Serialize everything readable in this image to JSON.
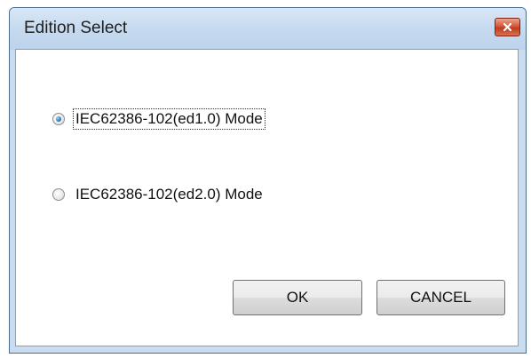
{
  "window": {
    "title": "Edition Select"
  },
  "options": [
    {
      "label": "IEC62386-102(ed1.0) Mode",
      "selected": true
    },
    {
      "label": "IEC62386-102(ed2.0) Mode",
      "selected": false
    }
  ],
  "buttons": {
    "ok_label": "OK",
    "cancel_label": "CANCEL"
  },
  "icons": {
    "close": "close-icon"
  },
  "colors": {
    "titlebar": "#c6daef",
    "close_button": "#c13c1c",
    "radio_selected": "#2a7ab8"
  }
}
